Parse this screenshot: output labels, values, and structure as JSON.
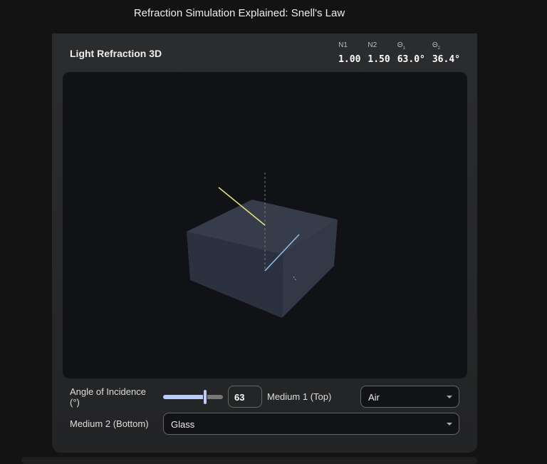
{
  "page_title": "Refraction Simulation Explained: Snell's Law",
  "card": {
    "title": "Light Refraction 3D",
    "stats": [
      {
        "label": "N1",
        "sub": "",
        "value": "1.00"
      },
      {
        "label": "N2",
        "sub": "",
        "value": "1.50"
      },
      {
        "label": "Θ",
        "sub": "1",
        "value": "63.0°"
      },
      {
        "label": "Θ",
        "sub": "2",
        "value": "36.4°"
      }
    ]
  },
  "controls": {
    "angle_label": "Angle of Incidence (°)",
    "angle_value": "63",
    "angle_fraction": 0.7,
    "medium1_label": "Medium 1 (Top)",
    "medium1_value": "Air",
    "medium2_label": "Medium 2 (Bottom)",
    "medium2_value": "Glass"
  },
  "colors": {
    "incident": "#e8e27a",
    "refracted": "#8ec3ef",
    "block": "#343a48"
  }
}
